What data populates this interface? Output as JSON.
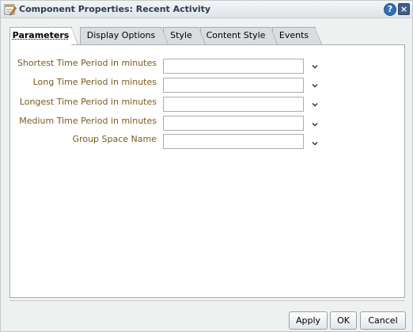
{
  "window": {
    "title": "Component Properties: Recent Activity",
    "help_label": "?",
    "close_label": "×"
  },
  "tabs": [
    {
      "label": "Parameters",
      "active": true
    },
    {
      "label": "Display Options",
      "active": false
    },
    {
      "label": "Style",
      "active": false
    },
    {
      "label": "Content Style",
      "active": false
    },
    {
      "label": "Events",
      "active": false
    }
  ],
  "fields": [
    {
      "label": "Shortest Time Period in minutes",
      "value": ""
    },
    {
      "label": "Long Time Period in minutes",
      "value": ""
    },
    {
      "label": "Longest Time Period in minutes",
      "value": ""
    },
    {
      "label": "Medium Time Period in minutes",
      "value": ""
    },
    {
      "label": "Group Space Name",
      "value": ""
    }
  ],
  "buttons": {
    "apply": "Apply",
    "ok": "OK",
    "cancel": "Cancel"
  },
  "colors": {
    "label_text": "#7a5a1c",
    "title_text": "#2b3b52",
    "help_blue": "#2f6fb5"
  },
  "icons": {
    "title": "edit-properties-icon",
    "field_action": "chevron-down-icon"
  }
}
